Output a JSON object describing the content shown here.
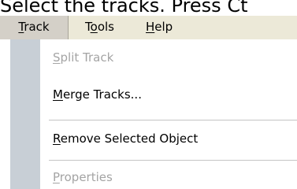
{
  "caption": "Select the tracks. Press Ct",
  "menubar": {
    "items": [
      {
        "label_first": "T",
        "label_rest": "rack"
      },
      {
        "label_first": "T",
        "label_u": "o",
        "label_rest": "ols"
      },
      {
        "label_first": "",
        "label_u": "H",
        "label_rest": "elp"
      }
    ]
  },
  "menu": {
    "split": {
      "label_u": "S",
      "label_rest": "plit Track"
    },
    "merge": {
      "label_u": "M",
      "label_rest": "erge Tracks..."
    },
    "remove": {
      "label_u": "R",
      "label_rest": "emove Selected Object"
    },
    "props": {
      "label_u": "P",
      "label_rest": "roperties"
    }
  }
}
